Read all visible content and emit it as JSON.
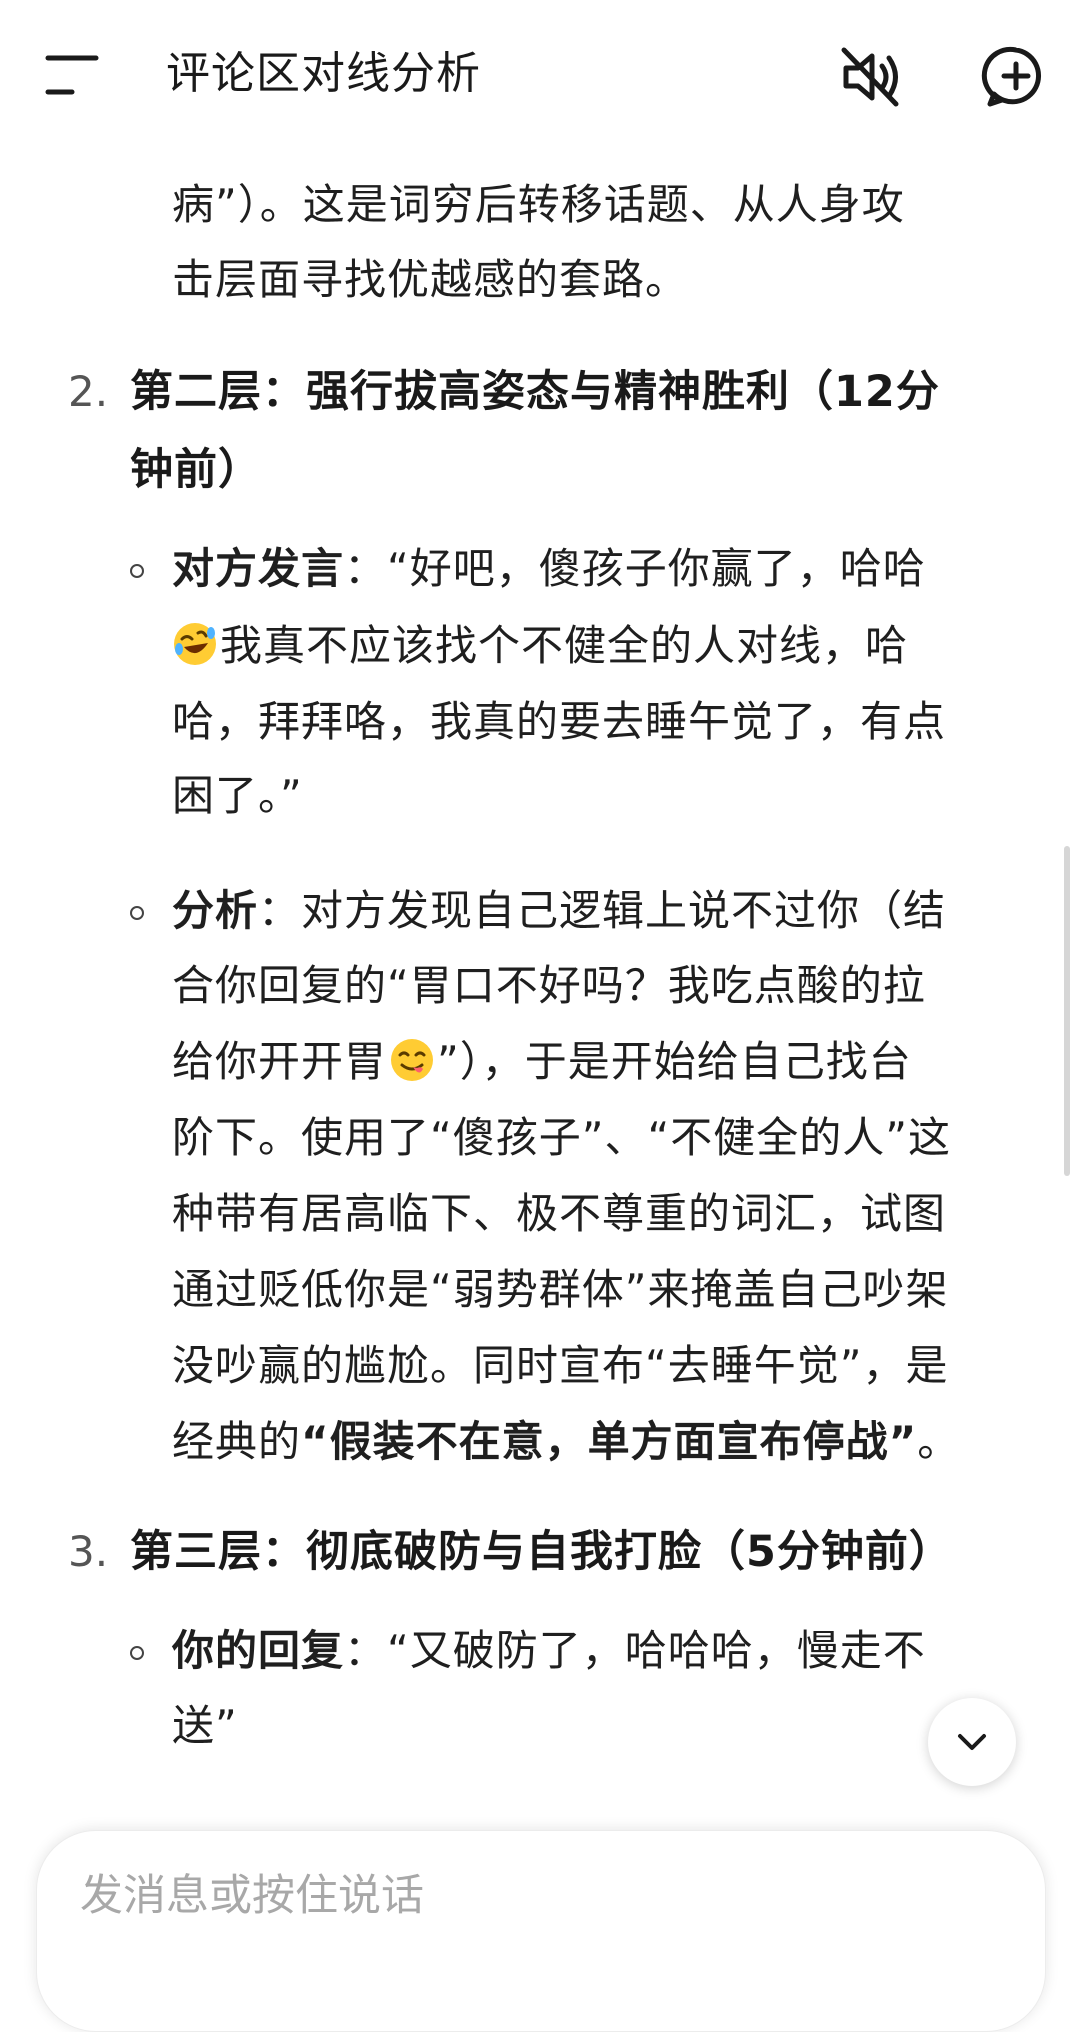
{
  "app": {
    "title": "评论区对线分析"
  },
  "header": {
    "menu_icon": "menu-icon",
    "mute_icon": "speaker-muted-icon",
    "new_chat_icon": "new-chat-plus-icon"
  },
  "message": {
    "intro": {
      "line1": "病”）。这是词穷后转移话题、从人身攻",
      "line2": "击层面寻找优越感的套路。"
    },
    "sec2": {
      "number": "2.",
      "title_line1": "第二层：强行拔高姿态与精神胜利（12分",
      "title_line2": "钟前）",
      "opponent_label": "对方发言",
      "opponent_l1": "：“好吧，傻孩子你赢了，哈哈",
      "emoji1_name": "rolling-on-floor-laughing-emoji",
      "opponent_l2": "我真不应该找个不健全的人对线，哈",
      "opponent_l3": "哈，拜拜咯，我真的要去睡午觉了，有点",
      "opponent_l4": "困了。”",
      "analysis_label": "分析",
      "analysis_l1": "：对方发现自己逻辑上说不过你（结",
      "analysis_l2": "合你回复的“胃口不好吗？我吃点酸的拉",
      "analysis_l3a": "给你开开胃",
      "emoji2_name": "face-savoring-food-emoji",
      "analysis_l3b": "”），于是开始给自己找台",
      "analysis_l4": "阶下。使用了“傻孩子”、“不健全的人”这",
      "analysis_l5": "种带有居高临下、极不尊重的词汇，试图",
      "analysis_l6": "通过贬低你是“弱势群体”来掩盖自己吵架",
      "analysis_l7": "没吵赢的尴尬。同时宣布“去睡午觉”，是",
      "analysis_l8a": "经典的",
      "analysis_l8b": "“假装不在意，单方面宣布停战”",
      "analysis_l8c": "。"
    },
    "sec3": {
      "number": "3.",
      "title": "第三层：彻底破防与自我打脸（5分钟前）",
      "reply_label": "你的回复",
      "reply_l1": "：“又破防了，哈哈哈，慢走不",
      "reply_l2": "送”"
    }
  },
  "composer": {
    "placeholder": "发消息或按住说话"
  },
  "controls": {
    "scroll_down_icon": "chevron-down-icon"
  },
  "colors": {
    "background": "#ffffff",
    "text": "#1f1f1f",
    "muted_text": "#a8a8a8",
    "list_number": "#555555"
  }
}
